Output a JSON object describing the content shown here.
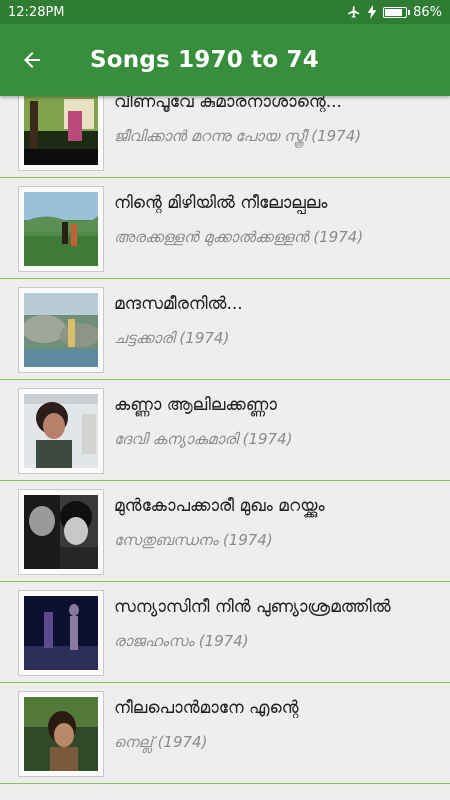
{
  "status": {
    "time": "12:28PM",
    "battery": "86%",
    "battery_level": 0.86
  },
  "header": {
    "title": "Songs 1970 to 74",
    "back_icon": "arrow-left-icon"
  },
  "accent": "#388e3c",
  "divider_color": "#8bc34a",
  "songs": [
    {
      "title": "വീണപൂവേ കുമാരനാശാന്റെ...",
      "film": "ജീവിക്കാൻ മറന്നു പോയ സ്ത്രീ  (1974)"
    },
    {
      "title": "നിന്റെ മിഴിയിൽ നീലോല്പലം",
      "film": "അരക്കള്ളൻ മുക്കാൽക്കള്ളൻ (1974)"
    },
    {
      "title": "മന്ദസമീരനിൽ...",
      "film": "ചട്ടക്കാരി (1974)"
    },
    {
      "title": "കണ്ണാ ആലിലക്കണ്ണാ",
      "film": "ദേവി കന്യാകുമാരി (1974)"
    },
    {
      "title": "മുൻകോപക്കാരീ മുഖം മറയ്ക്കും",
      "film": "സേതുബന്ധനം (1974)"
    },
    {
      "title": "സന്യാസിനീ നിൻ പുണ്യാശ്രമത്തിൽ",
      "film": "രാജഹംസം (1974)"
    },
    {
      "title": "നീലപൊൻമാനേ എന്റെ",
      "film": "നെല്ല് (1974)"
    }
  ]
}
